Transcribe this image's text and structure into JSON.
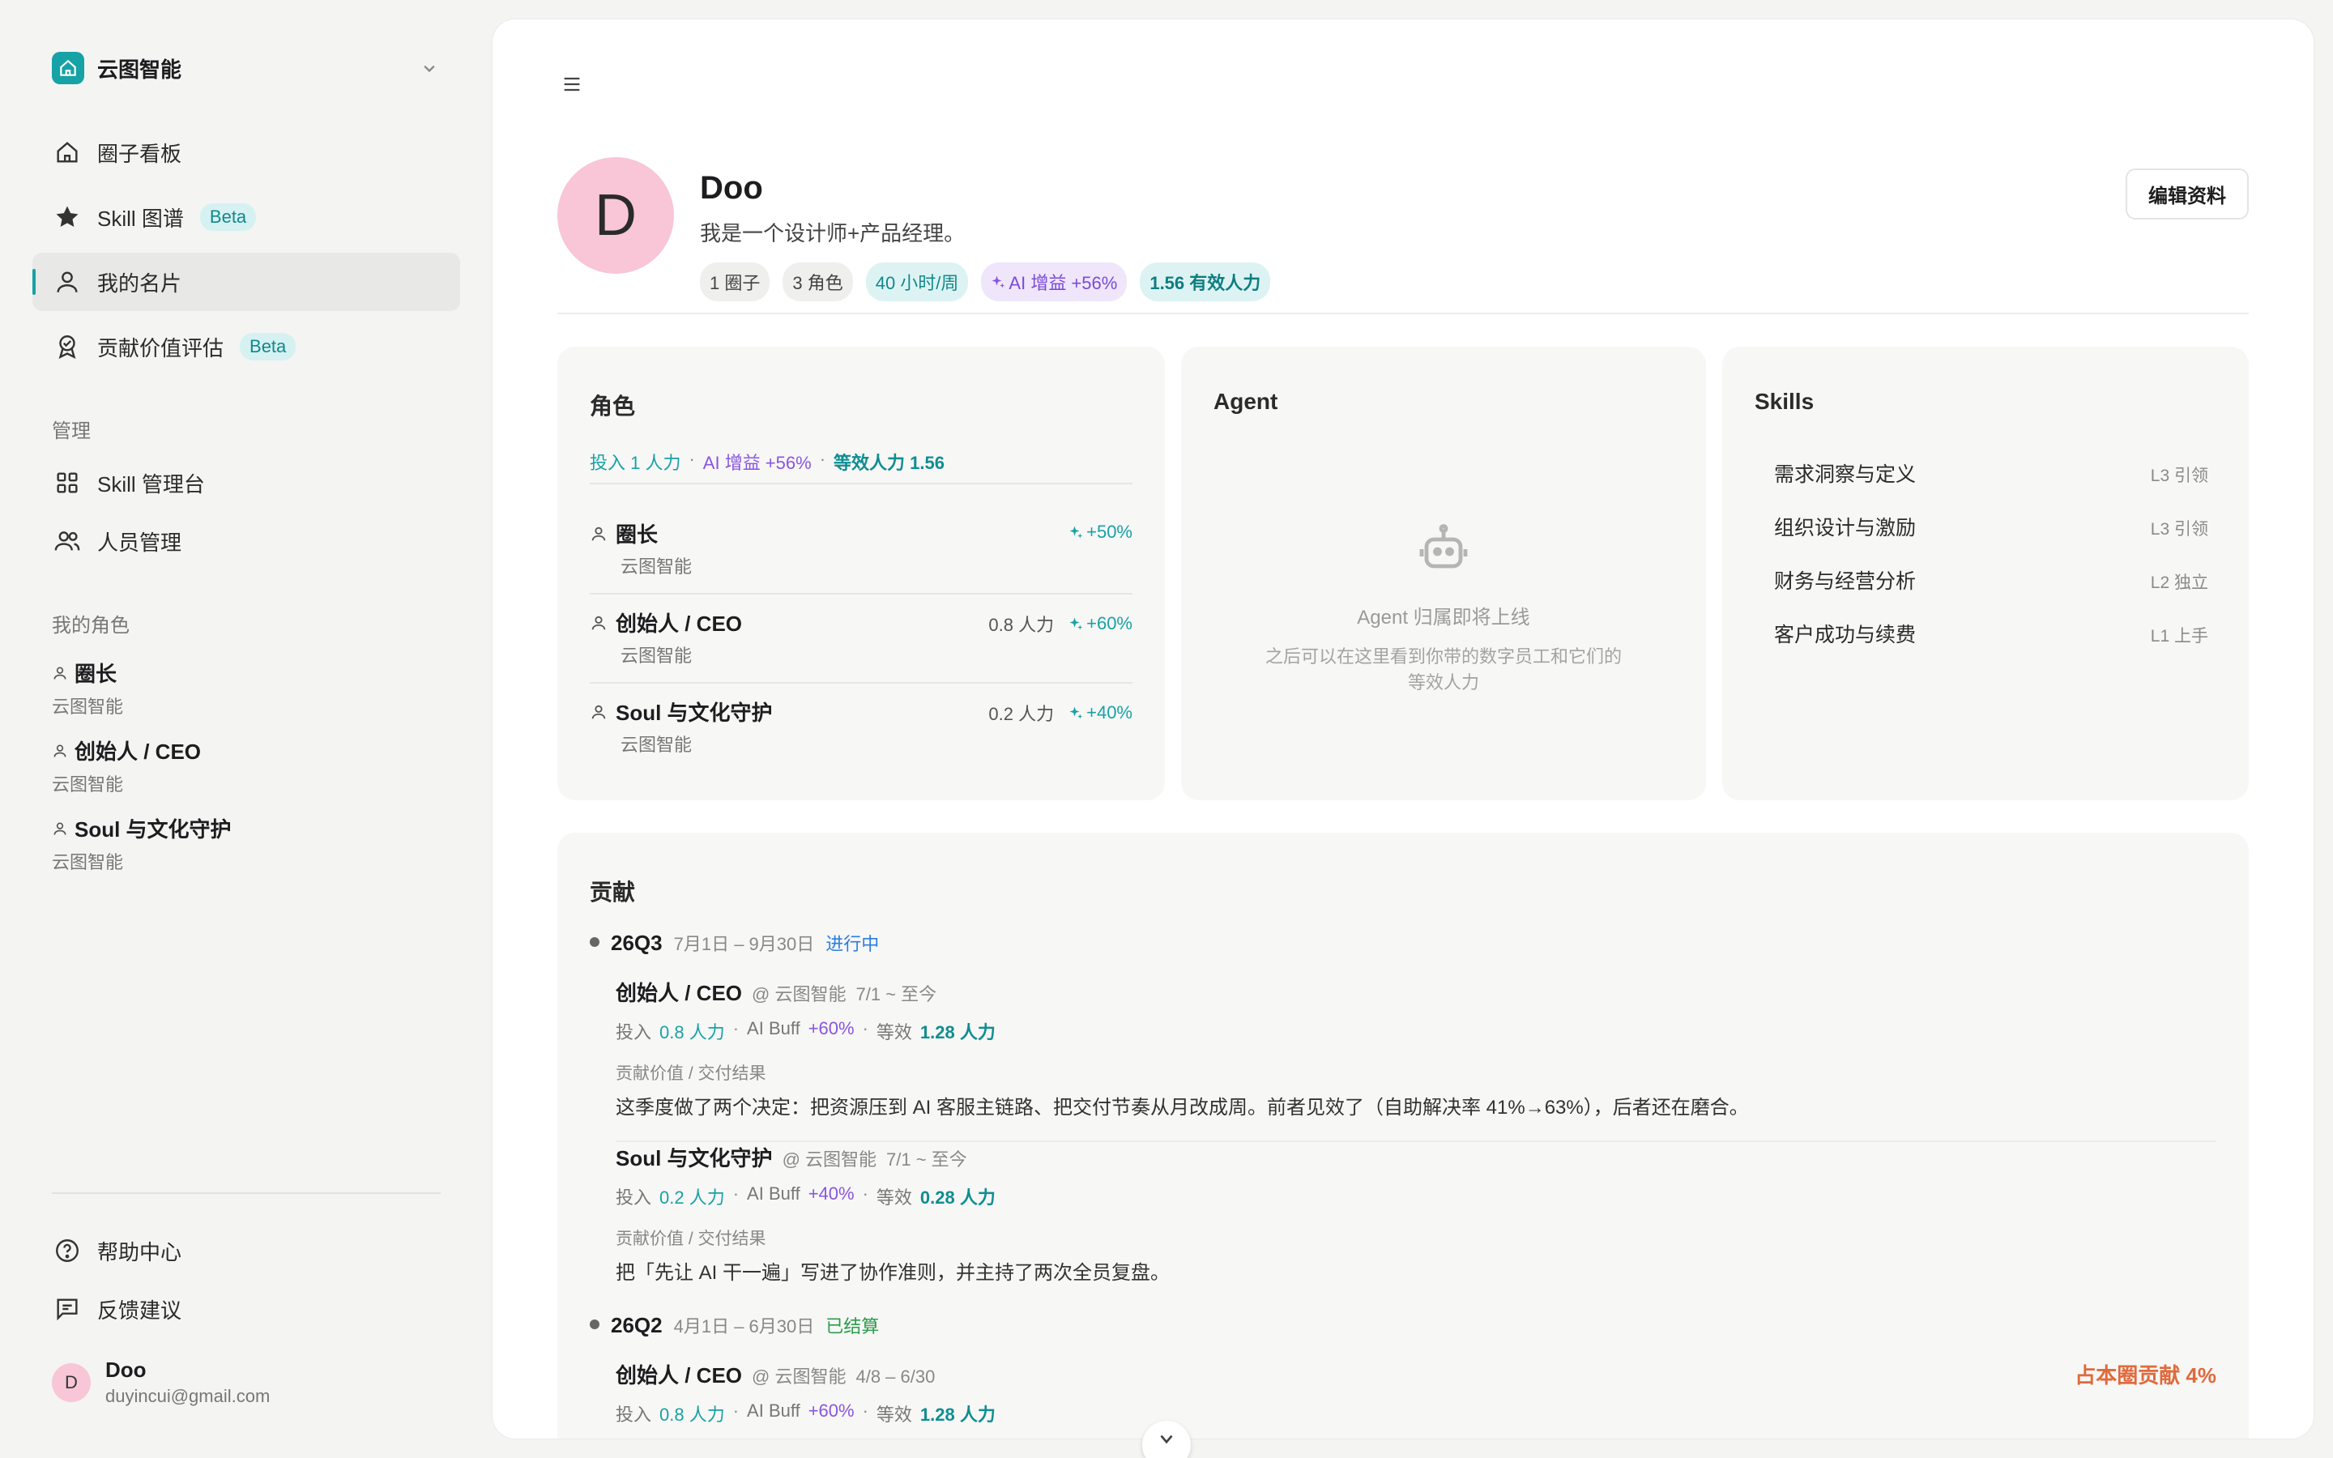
{
  "sidebar": {
    "org_name": "云图智能",
    "nav": [
      {
        "label": "圈子看板"
      },
      {
        "label": "Skill 图谱",
        "badge": "Beta"
      },
      {
        "label": "我的名片"
      },
      {
        "label": "贡献价值评估",
        "badge": "Beta"
      }
    ],
    "manage_label": "管理",
    "manage": [
      {
        "label": "Skill 管理台"
      },
      {
        "label": "人员管理"
      }
    ],
    "my_roles_label": "我的角色",
    "roles": [
      {
        "name": "圈长",
        "org": "云图智能"
      },
      {
        "name": "创始人 / CEO",
        "org": "云图智能"
      },
      {
        "name": "Soul 与文化守护",
        "org": "云图智能"
      }
    ],
    "footer": [
      {
        "label": "帮助中心"
      },
      {
        "label": "反馈建议"
      }
    ],
    "user": {
      "initial": "D",
      "name": "Doo",
      "email": "duyincui@gmail.com"
    }
  },
  "profile": {
    "initial": "D",
    "name": "Doo",
    "bio": "我是一个设计师+产品经理。",
    "chips": [
      "1 圈子",
      "3 角色",
      "40 小时/周",
      "AI 增益 +56%",
      "1.56 有效人力"
    ],
    "edit_label": "编辑资料"
  },
  "roles_card": {
    "title": "角色",
    "summary": {
      "input": "投入 1 人力",
      "ai": "AI 增益 +56%",
      "equiv": "等效人力 1.56"
    },
    "rows": [
      {
        "name": "圈长",
        "org": "云图智能",
        "fte": "",
        "buff": "+50%"
      },
      {
        "name": "创始人 / CEO",
        "org": "云图智能",
        "fte": "0.8 人力",
        "buff": "+60%"
      },
      {
        "name": "Soul 与文化守护",
        "org": "云图智能",
        "fte": "0.2 人力",
        "buff": "+40%"
      }
    ]
  },
  "agent_card": {
    "title": "Agent",
    "empty_title": "Agent 归属即将上线",
    "empty_sub": "之后可以在这里看到你带的数字员工和它们的等效人力"
  },
  "skills_card": {
    "title": "Skills",
    "items": [
      {
        "name": "需求洞察与定义",
        "level": "L3 引领"
      },
      {
        "name": "组织设计与激励",
        "level": "L3 引领"
      },
      {
        "name": "财务与经营分析",
        "level": "L2 独立"
      },
      {
        "name": "客户成功与续费",
        "level": "L1 上手"
      }
    ]
  },
  "contrib": {
    "title": "贡献",
    "quarters": [
      {
        "name": "26Q3",
        "range": "7月1日 – 9月30日",
        "status": "进行中",
        "entries": [
          {
            "role": "创始人 / CEO",
            "org": "@ 云图智能",
            "period": "7/1 ~ 至今",
            "input_lbl": "投入",
            "input": "0.8 人力",
            "buff_lbl": "AI Buff",
            "buff": "+60%",
            "eq_lbl": "等效",
            "eq": "1.28 人力",
            "value_lbl": "贡献价值 / 交付结果",
            "text": "这季度做了两个决定：把资源压到 AI 客服主链路、把交付节奏从月改成周。前者见效了（自助解决率 41%→63%），后者还在磨合。"
          },
          {
            "role": "Soul 与文化守护",
            "org": "@ 云图智能",
            "period": "7/1 ~ 至今",
            "input_lbl": "投入",
            "input": "0.2 人力",
            "buff_lbl": "AI Buff",
            "buff": "+40%",
            "eq_lbl": "等效",
            "eq": "0.28 人力",
            "value_lbl": "贡献价值 / 交付结果",
            "text": "把「先让 AI 干一遍」写进了协作准则，并主持了两次全员复盘。"
          }
        ]
      },
      {
        "name": "26Q2",
        "range": "4月1日 – 6月30日",
        "status": "已结算",
        "entries": [
          {
            "role": "创始人 / CEO",
            "org": "@ 云图智能",
            "period": "4/8 – 6/30",
            "input_lbl": "投入",
            "input": "0.8 人力",
            "buff_lbl": "AI Buff",
            "buff": "+60%",
            "eq_lbl": "等效",
            "eq": "1.28 人力",
            "share": "占本圈贡献 4%"
          }
        ]
      }
    ]
  }
}
